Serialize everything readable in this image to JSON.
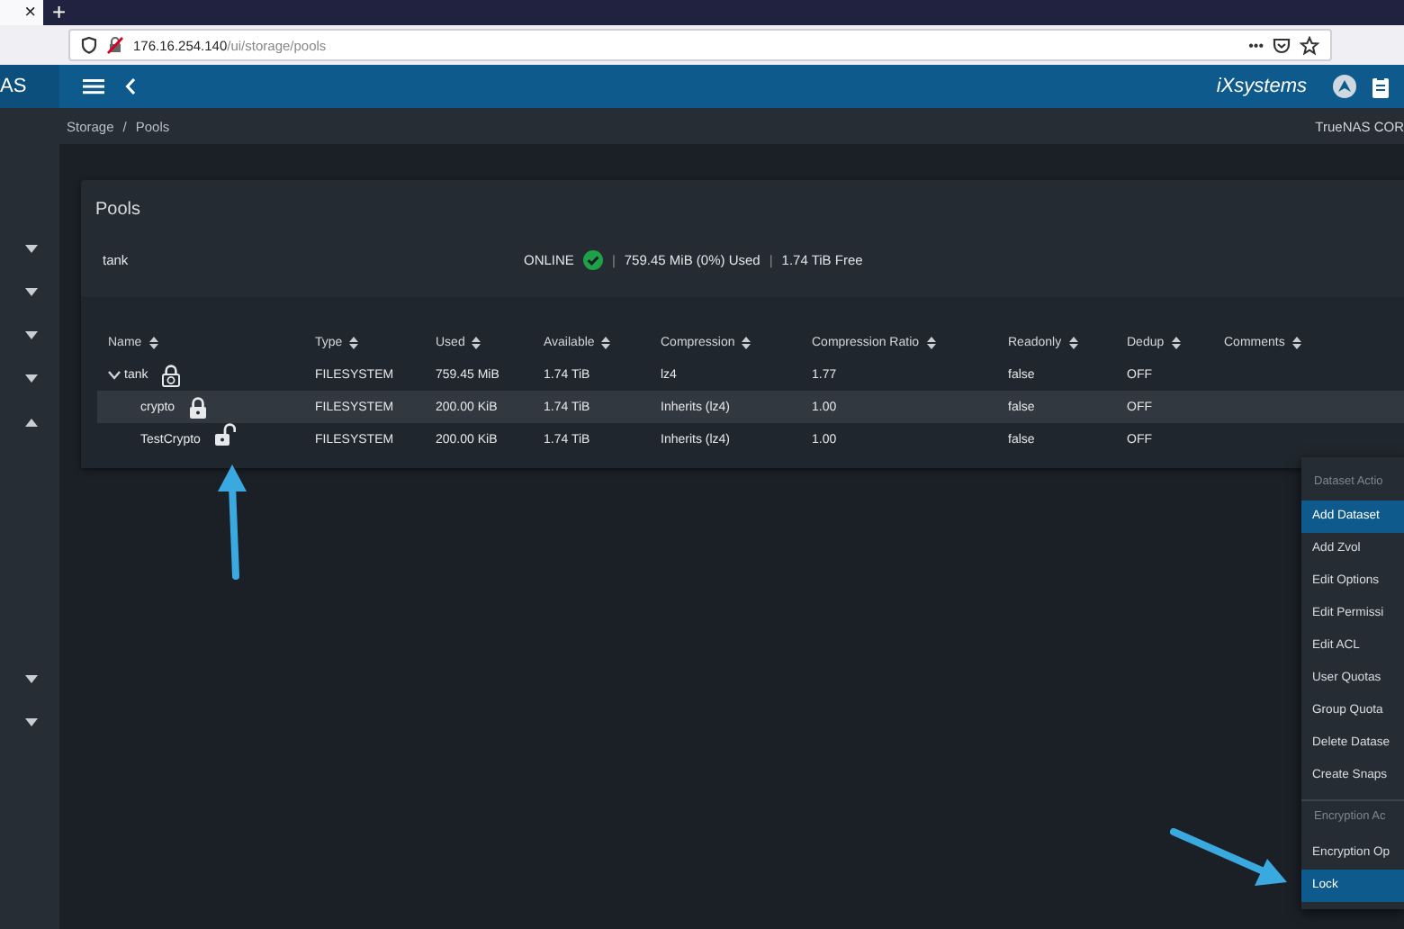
{
  "browser": {
    "tab_close": "×",
    "new_tab": "+",
    "url_host": "176.16.254.140",
    "url_path": "/ui/storage/pools",
    "more": "•••"
  },
  "topbar": {
    "brand_cut": "AS",
    "logo": "iXsystems"
  },
  "sidebar": {
    "items": [
      {
        "expanded": false
      },
      {
        "expanded": false
      },
      {
        "expanded": false
      },
      {
        "expanded": false
      },
      {
        "expanded": true
      },
      {
        "expanded": false
      },
      {
        "expanded": false
      }
    ]
  },
  "breadcrumb": {
    "items": [
      "Storage",
      "Pools"
    ],
    "separator": "/",
    "product": "TrueNAS COR"
  },
  "pool": {
    "title": "Pools",
    "name": "tank",
    "status": "ONLINE",
    "separator": "|",
    "used": "759.45 MiB (0%) Used",
    "free": "1.74 TiB Free",
    "table": {
      "columns": [
        "Name",
        "Type",
        "Used",
        "Available",
        "Compression",
        "Compression Ratio",
        "Readonly",
        "Dedup",
        "Comments"
      ],
      "rows": [
        {
          "kind": "root",
          "selected": false,
          "expanded": true,
          "cells": [
            "tank",
            "FILESYSTEM",
            "759.45 MiB",
            "1.74 TiB",
            "lz4",
            "1.77",
            "false",
            "OFF"
          ],
          "children": [
            {
              "kind": "locked",
              "selected": true,
              "cells": [
                "crypto",
                "FILESYSTEM",
                "200.00 KiB",
                "1.74 TiB",
                "Inherits (lz4)",
                "1.00",
                "false",
                "OFF"
              ]
            },
            {
              "kind": "unlocked",
              "selected": false,
              "cells": [
                "TestCrypto",
                "FILESYSTEM",
                "200.00 KiB",
                "1.74 TiB",
                "Inherits (lz4)",
                "1.00",
                "false",
                "OFF"
              ]
            }
          ]
        }
      ]
    }
  },
  "menu": {
    "sections": [
      {
        "title": "Dataset Actio",
        "items": [
          {
            "label": "Add Dataset",
            "selected": true
          },
          {
            "label": "Add Zvol",
            "selected": false
          },
          {
            "label": "Edit Options",
            "selected": false
          },
          {
            "label": "Edit Permissi",
            "selected": false
          },
          {
            "label": "Edit ACL",
            "selected": false
          },
          {
            "label": "User Quotas",
            "selected": false
          },
          {
            "label": "Group Quota",
            "selected": false
          },
          {
            "label": "Delete Datase",
            "selected": false
          },
          {
            "label": "Create Snaps",
            "selected": false
          }
        ]
      },
      {
        "title": "Encryption Ac",
        "items": [
          {
            "label": "Encryption Op",
            "selected": false
          },
          {
            "label": "Lock",
            "selected": true
          }
        ]
      }
    ]
  }
}
